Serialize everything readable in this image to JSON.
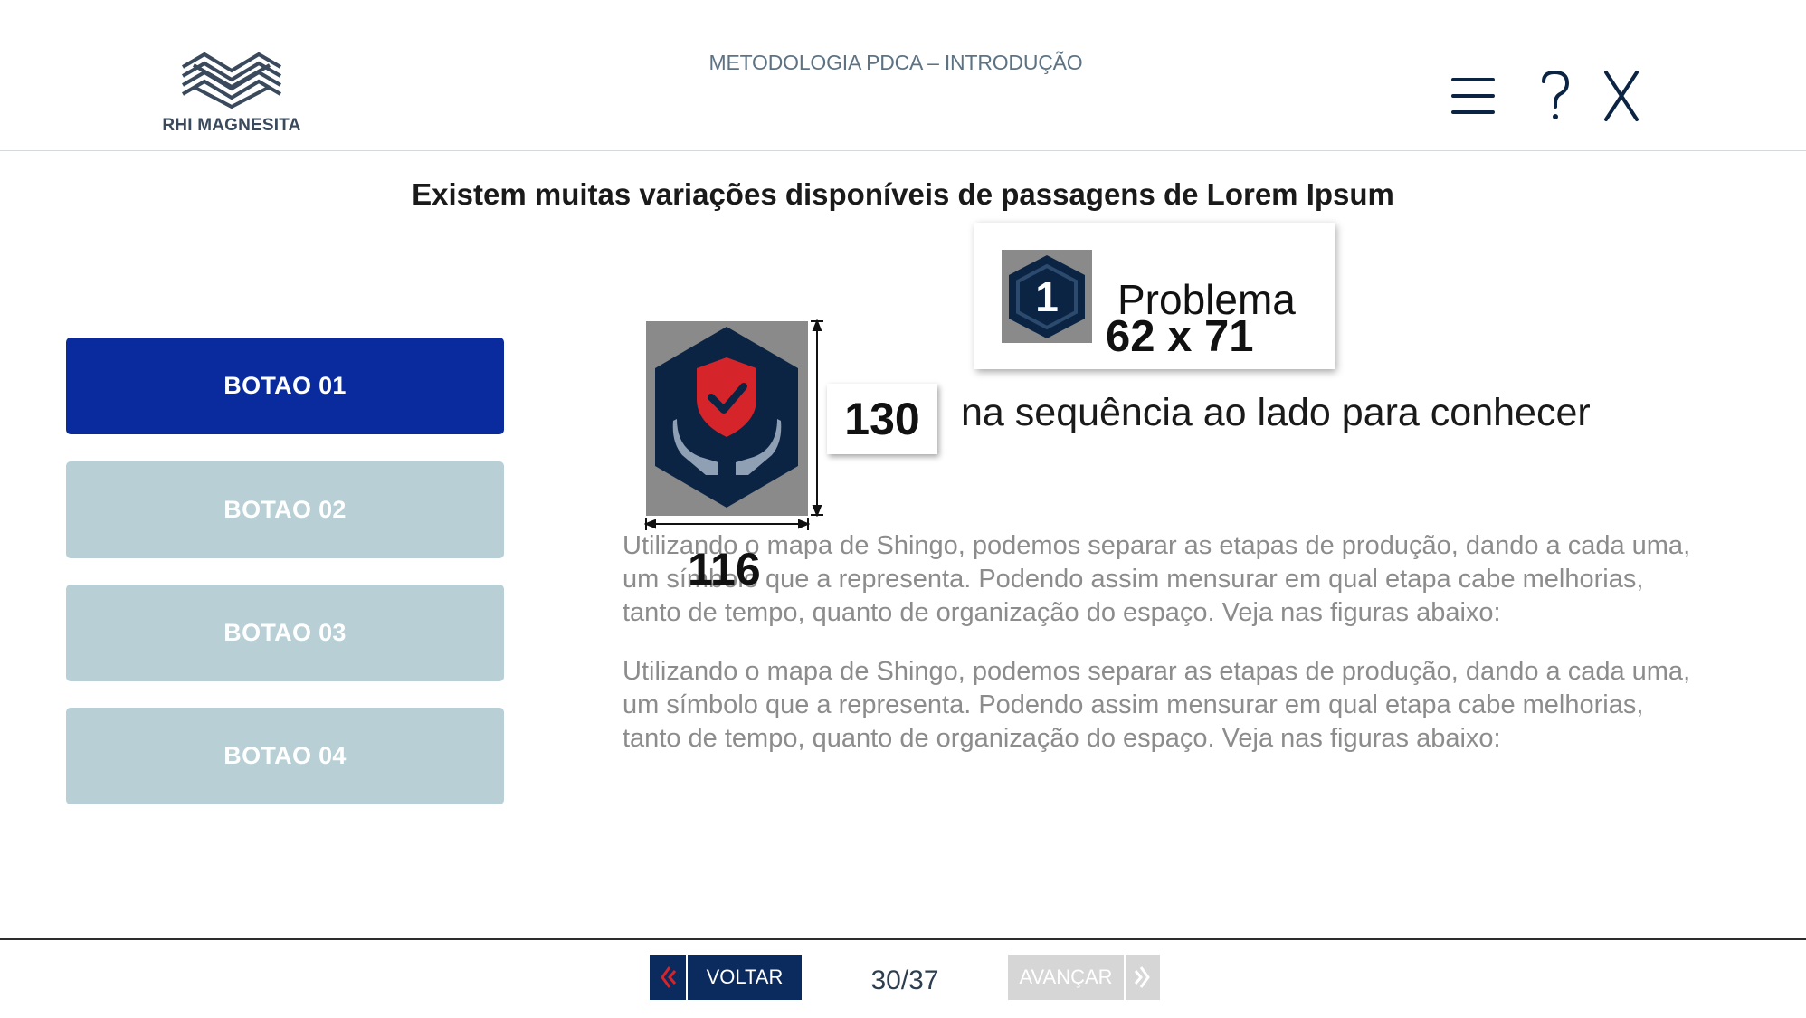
{
  "header": {
    "logo_text": "RHI MAGNESITA",
    "course_title": "METODOLOGIA PDCA – INTRODUÇÃO",
    "icons": [
      "menu-icon",
      "help-icon",
      "close-icon"
    ]
  },
  "main": {
    "heading": "Existem muitas variações disponíveis de passagens de Lorem Ipsum",
    "buttons": [
      {
        "label": "BOTAO 01",
        "state": "active"
      },
      {
        "label": "BOTAO 02",
        "state": "inactive"
      },
      {
        "label": "BOTAO 03",
        "state": "inactive"
      },
      {
        "label": "BOTAO 04",
        "state": "inactive"
      }
    ],
    "dimension_height": "130",
    "dimension_width": "116",
    "card": {
      "number": "1",
      "label": "Problema",
      "dimensions": "62 x 71"
    },
    "instruction": "na sequência ao lado para conhecer",
    "paragraphs": [
      "Utilizando o mapa de Shingo, podemos separar as etapas de produção, dando a cada uma, um símbolo que a representa. Podendo assim mensurar em qual etapa cabe melhorias, tanto de tempo, quanto de organização do espaço. Veja nas figuras abaixo:",
      "Utilizando o mapa de Shingo, podemos separar as etapas de produção, dando a cada uma, um símbolo que a representa. Podendo assim mensurar em qual etapa cabe melhorias, tanto de tempo, quanto de organização do espaço. Veja nas figuras abaixo:"
    ]
  },
  "footer": {
    "back_label": "VOLTAR",
    "page": "30/37",
    "next_label": "AVANÇAR"
  },
  "colors": {
    "primary_active": "#0a2b9e",
    "inactive_button": "#b7cfd5",
    "nav_back": "#0b2a5e",
    "nav_next_disabled": "#d6d6d6",
    "icon_navy": "#0c2444",
    "icon_red": "#d6242b"
  }
}
